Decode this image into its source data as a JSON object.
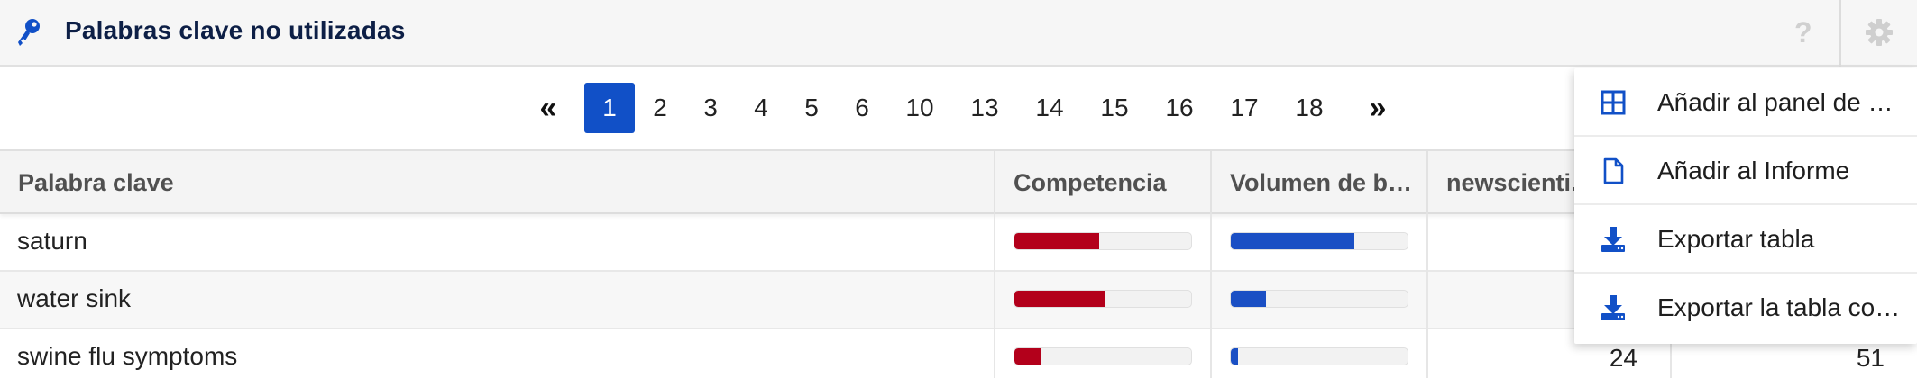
{
  "header": {
    "title": "Palabras clave no utilizadas",
    "help_symbol": "?",
    "icon": "key-icon",
    "settings_icon": "gear-icon",
    "accent_color": "#1150c7",
    "title_color": "#0d1f46"
  },
  "pagination": {
    "prev_symbol": "«",
    "next_symbol": "»",
    "pages": [
      "1",
      "2",
      "3",
      "4",
      "5",
      "6",
      "10",
      "13",
      "14",
      "15",
      "16",
      "17",
      "18"
    ],
    "active_page": "1"
  },
  "table": {
    "columns": [
      "Palabra clave",
      "Competencia",
      "Volumen de b…",
      "newscienti…",
      ""
    ],
    "rows": [
      {
        "keyword": "saturn",
        "competencia": 0.48,
        "volumen": 0.7,
        "newscientist": "",
        "last": ""
      },
      {
        "keyword": "water sink",
        "competencia": 0.51,
        "volumen": 0.2,
        "newscientist": "",
        "last": ""
      },
      {
        "keyword": "swine flu symptoms",
        "competencia": 0.15,
        "volumen": 0.04,
        "newscientist": "24",
        "last": "51"
      }
    ],
    "competencia_color": "#b3001b",
    "volumen_color": "#1a4fc4"
  },
  "menu": {
    "items": [
      {
        "label": "Añadir al panel de …",
        "icon": "dashboard-grid-icon"
      },
      {
        "label": "Añadir al Informe",
        "icon": "document-icon"
      },
      {
        "label": "Exportar tabla",
        "icon": "download-icon"
      },
      {
        "label": "Exportar la tabla co…",
        "icon": "download-icon"
      }
    ]
  }
}
